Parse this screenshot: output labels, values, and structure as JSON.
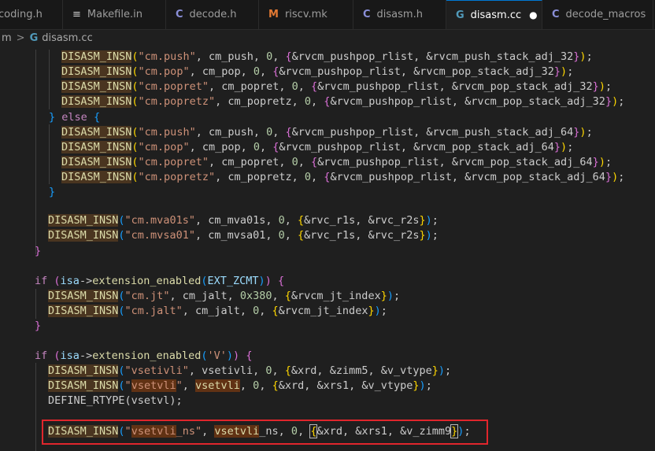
{
  "tabs": [
    {
      "label": "coding.h",
      "icon": "c-header-icon",
      "glyph": "",
      "active": false
    },
    {
      "label": "Makefile.in",
      "icon": "lines-icon",
      "glyph": "≡",
      "active": false
    },
    {
      "label": "decode.h",
      "icon": "c-header-icon",
      "glyph": "C",
      "active": false
    },
    {
      "label": "riscv.mk",
      "icon": "makefile-icon",
      "glyph": "M",
      "active": false
    },
    {
      "label": "disasm.h",
      "icon": "c-header-icon",
      "glyph": "C",
      "active": false
    },
    {
      "label": "disasm.cc",
      "icon": "cpp-icon",
      "glyph": "G",
      "active": true,
      "modified": "●"
    },
    {
      "label": "decode_macros",
      "icon": "c-header-icon",
      "glyph": "C",
      "active": false
    }
  ],
  "breadcrumb": {
    "parent": "m",
    "separator": ">",
    "file": "disasm.cc",
    "file_glyph": "G"
  },
  "code": [
    [
      [
        "mac",
        "DISASM_INSN"
      ],
      [
        "b1",
        "("
      ],
      [
        "str",
        "\"cm.push\""
      ],
      [
        "sym",
        ", cm_push, "
      ],
      [
        "num",
        "0"
      ],
      [
        "sym",
        ", "
      ],
      [
        "b2",
        "{"
      ],
      [
        "sym",
        "&rvcm_pushpop_rlist, &rvcm_push_stack_adj_32"
      ],
      [
        "b2",
        "}"
      ],
      [
        "b1",
        ")"
      ],
      [
        "sym",
        ";"
      ]
    ],
    [
      [
        "mac",
        "DISASM_INSN"
      ],
      [
        "b1",
        "("
      ],
      [
        "str",
        "\"cm.pop\""
      ],
      [
        "sym",
        ", cm_pop, "
      ],
      [
        "num",
        "0"
      ],
      [
        "sym",
        ", "
      ],
      [
        "b2",
        "{"
      ],
      [
        "sym",
        "&rvcm_pushpop_rlist, &rvcm_pop_stack_adj_32"
      ],
      [
        "b2",
        "}"
      ],
      [
        "b1",
        ")"
      ],
      [
        "sym",
        ";"
      ]
    ],
    [
      [
        "mac",
        "DISASM_INSN"
      ],
      [
        "b1",
        "("
      ],
      [
        "str",
        "\"cm.popret\""
      ],
      [
        "sym",
        ", cm_popret, "
      ],
      [
        "num",
        "0"
      ],
      [
        "sym",
        ", "
      ],
      [
        "b2",
        "{"
      ],
      [
        "sym",
        "&rvcm_pushpop_rlist, &rvcm_pop_stack_adj_32"
      ],
      [
        "b2",
        "}"
      ],
      [
        "b1",
        ")"
      ],
      [
        "sym",
        ";"
      ]
    ],
    [
      [
        "mac",
        "DISASM_INSN"
      ],
      [
        "b1",
        "("
      ],
      [
        "str",
        "\"cm.popretz\""
      ],
      [
        "sym",
        ", cm_popretz, "
      ],
      [
        "num",
        "0"
      ],
      [
        "sym",
        ", "
      ],
      [
        "b2",
        "{"
      ],
      [
        "sym",
        "&rvcm_pushpop_rlist, &rvcm_pop_stack_adj_32"
      ],
      [
        "b2",
        "}"
      ],
      [
        "b1",
        ")"
      ],
      [
        "sym",
        ";"
      ]
    ],
    [
      [
        "b3",
        "}"
      ],
      [
        "sym",
        " "
      ],
      [
        "ctl",
        "else"
      ],
      [
        "sym",
        " "
      ],
      [
        "b3",
        "{"
      ]
    ],
    [
      [
        "mac",
        "DISASM_INSN"
      ],
      [
        "b1",
        "("
      ],
      [
        "str",
        "\"cm.push\""
      ],
      [
        "sym",
        ", cm_push, "
      ],
      [
        "num",
        "0"
      ],
      [
        "sym",
        ", "
      ],
      [
        "b2",
        "{"
      ],
      [
        "sym",
        "&rvcm_pushpop_rlist, &rvcm_push_stack_adj_64"
      ],
      [
        "b2",
        "}"
      ],
      [
        "b1",
        ")"
      ],
      [
        "sym",
        ";"
      ]
    ],
    [
      [
        "mac",
        "DISASM_INSN"
      ],
      [
        "b1",
        "("
      ],
      [
        "str",
        "\"cm.pop\""
      ],
      [
        "sym",
        ", cm_pop, "
      ],
      [
        "num",
        "0"
      ],
      [
        "sym",
        ", "
      ],
      [
        "b2",
        "{"
      ],
      [
        "sym",
        "&rvcm_pushpop_rlist, &rvcm_pop_stack_adj_64"
      ],
      [
        "b2",
        "}"
      ],
      [
        "b1",
        ")"
      ],
      [
        "sym",
        ";"
      ]
    ],
    [
      [
        "mac",
        "DISASM_INSN"
      ],
      [
        "b1",
        "("
      ],
      [
        "str",
        "\"cm.popret\""
      ],
      [
        "sym",
        ", cm_popret, "
      ],
      [
        "num",
        "0"
      ],
      [
        "sym",
        ", "
      ],
      [
        "b2",
        "{"
      ],
      [
        "sym",
        "&rvcm_pushpop_rlist, &rvcm_pop_stack_adj_64"
      ],
      [
        "b2",
        "}"
      ],
      [
        "b1",
        ")"
      ],
      [
        "sym",
        ";"
      ]
    ],
    [
      [
        "mac",
        "DISASM_INSN"
      ],
      [
        "b1",
        "("
      ],
      [
        "str",
        "\"cm.popretz\""
      ],
      [
        "sym",
        ", cm_popretz, "
      ],
      [
        "num",
        "0"
      ],
      [
        "sym",
        ", "
      ],
      [
        "b2",
        "{"
      ],
      [
        "sym",
        "&rvcm_pushpop_rlist, &rvcm_pop_stack_adj_64"
      ],
      [
        "b2",
        "}"
      ],
      [
        "b1",
        ")"
      ],
      [
        "sym",
        ";"
      ]
    ],
    [
      [
        "b3",
        "}"
      ]
    ],
    [],
    [
      [
        "mac",
        "DISASM_INSN"
      ],
      [
        "b3",
        "("
      ],
      [
        "str",
        "\"cm.mva01s\""
      ],
      [
        "sym",
        ", cm_mva01s, "
      ],
      [
        "num",
        "0"
      ],
      [
        "sym",
        ", "
      ],
      [
        "b1",
        "{"
      ],
      [
        "sym",
        "&rvc_r1s, &rvc_r2s"
      ],
      [
        "b1",
        "}"
      ],
      [
        "b3",
        ")"
      ],
      [
        "sym",
        ";"
      ]
    ],
    [
      [
        "mac",
        "DISASM_INSN"
      ],
      [
        "b3",
        "("
      ],
      [
        "str",
        "\"cm.mvsa01\""
      ],
      [
        "sym",
        ", cm_mvsa01, "
      ],
      [
        "num",
        "0"
      ],
      [
        "sym",
        ", "
      ],
      [
        "b1",
        "{"
      ],
      [
        "sym",
        "&rvc_r1s, &rvc_r2s"
      ],
      [
        "b1",
        "}"
      ],
      [
        "b3",
        ")"
      ],
      [
        "sym",
        ";"
      ]
    ],
    [
      [
        "b2",
        "}"
      ]
    ],
    [],
    [
      [
        "ctl",
        "if"
      ],
      [
        "sym",
        " "
      ],
      [
        "b2",
        "("
      ],
      [
        "id",
        "isa"
      ],
      [
        "sym",
        "->"
      ],
      [
        "fn",
        "extension_enabled"
      ],
      [
        "b3",
        "("
      ],
      [
        "id",
        "EXT_ZCMT"
      ],
      [
        "b3",
        ")"
      ],
      [
        "b2",
        ")"
      ],
      [
        "sym",
        " "
      ],
      [
        "b2",
        "{"
      ]
    ],
    [
      [
        "mac",
        "DISASM_INSN"
      ],
      [
        "b3",
        "("
      ],
      [
        "str",
        "\"cm.jt\""
      ],
      [
        "sym",
        ", cm_jalt, "
      ],
      [
        "num",
        "0x380"
      ],
      [
        "sym",
        ", "
      ],
      [
        "b1",
        "{"
      ],
      [
        "sym",
        "&rvcm_jt_index"
      ],
      [
        "b1",
        "}"
      ],
      [
        "b3",
        ")"
      ],
      [
        "sym",
        ";"
      ]
    ],
    [
      [
        "mac",
        "DISASM_INSN"
      ],
      [
        "b3",
        "("
      ],
      [
        "str",
        "\"cm.jalt\""
      ],
      [
        "sym",
        ", cm_jalt, "
      ],
      [
        "num",
        "0"
      ],
      [
        "sym",
        ", "
      ],
      [
        "b1",
        "{"
      ],
      [
        "sym",
        "&rvcm_jt_index"
      ],
      [
        "b1",
        "}"
      ],
      [
        "b3",
        ")"
      ],
      [
        "sym",
        ";"
      ]
    ],
    [
      [
        "b2",
        "}"
      ]
    ],
    [],
    [
      [
        "ctl",
        "if"
      ],
      [
        "sym",
        " "
      ],
      [
        "b2",
        "("
      ],
      [
        "id",
        "isa"
      ],
      [
        "sym",
        "->"
      ],
      [
        "fn",
        "extension_enabled"
      ],
      [
        "b3",
        "("
      ],
      [
        "str",
        "'V'"
      ],
      [
        "b3",
        ")"
      ],
      [
        "b2",
        ")"
      ],
      [
        "sym",
        " "
      ],
      [
        "b2",
        "{"
      ]
    ],
    [
      [
        "mac",
        "DISASM_INSN"
      ],
      [
        "b3",
        "("
      ],
      [
        "str",
        "\"vsetivli\""
      ],
      [
        "sym",
        ", vsetivli, "
      ],
      [
        "num",
        "0"
      ],
      [
        "sym",
        ", "
      ],
      [
        "b1",
        "{"
      ],
      [
        "sym",
        "&xrd, &zimm5, &v_vtype"
      ],
      [
        "b1",
        "}"
      ],
      [
        "b3",
        ")"
      ],
      [
        "sym",
        ";"
      ]
    ],
    [
      [
        "mac",
        "DISASM_INSN"
      ],
      [
        "b3",
        "("
      ],
      [
        "str",
        "\""
      ],
      [
        "strhl",
        "vsetvli"
      ],
      [
        "str",
        "\""
      ],
      [
        "sym",
        ", "
      ],
      [
        "hl",
        "vsetvli"
      ],
      [
        "sym",
        ", "
      ],
      [
        "num",
        "0"
      ],
      [
        "sym",
        ", "
      ],
      [
        "b1",
        "{"
      ],
      [
        "sym",
        "&xrd, &xrs1, &v_vtype"
      ],
      [
        "b1",
        "}"
      ],
      [
        "b3",
        ")"
      ],
      [
        "sym",
        ";"
      ]
    ],
    [
      [
        "sym",
        "DEFINE_RTYPE(vsetvl);"
      ]
    ],
    [],
    [
      [
        "mac",
        "DISASM_INSN"
      ],
      [
        "b3",
        "("
      ],
      [
        "str",
        "\""
      ],
      [
        "strhl",
        "vsetvli"
      ],
      [
        "str",
        "_ns\""
      ],
      [
        "sym",
        ", "
      ],
      [
        "hl",
        "vsetvli"
      ],
      [
        "sym",
        "_ns, "
      ],
      [
        "num",
        "0"
      ],
      [
        "sym",
        ", "
      ],
      [
        "b1box",
        "{"
      ],
      [
        "sym",
        "&xrd, &xrs1, &v_zimm9"
      ],
      [
        "b1box",
        "}"
      ],
      [
        "b3",
        ")"
      ],
      [
        "sym",
        ";"
      ]
    ]
  ],
  "colors": {
    "accent": "#0078d4",
    "highlight_box": "#e0262c",
    "background": "#1f1f1f"
  }
}
